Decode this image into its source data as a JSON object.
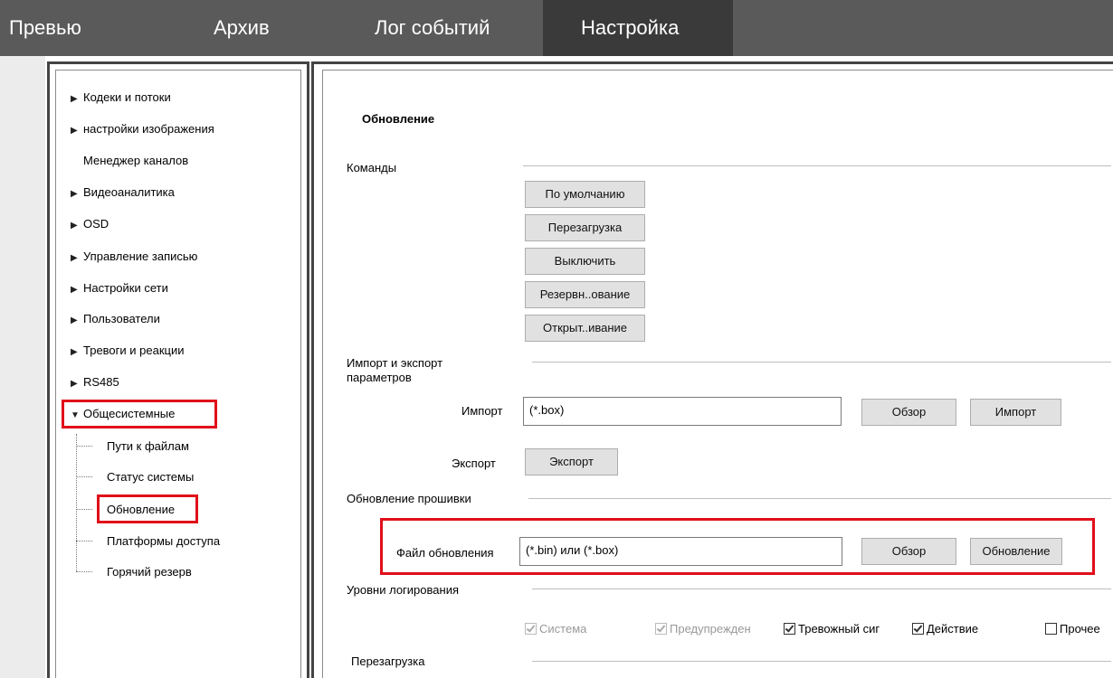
{
  "nav": {
    "tabs": [
      {
        "label": "Превью"
      },
      {
        "label": "Архив"
      },
      {
        "label": "Лог событий"
      },
      {
        "label": "Настройка"
      }
    ]
  },
  "tree": {
    "items": [
      {
        "label": "Кодеки и потоки"
      },
      {
        "label": "настройки изображения"
      },
      {
        "label": "Менеджер каналов"
      },
      {
        "label": "Видеоаналитика"
      },
      {
        "label": "OSD"
      },
      {
        "label": "Управление записью"
      },
      {
        "label": "Настройки сети"
      },
      {
        "label": "Пользователи"
      },
      {
        "label": "Тревоги и реакции"
      },
      {
        "label": "RS485"
      },
      {
        "label": "Общесистемные"
      }
    ],
    "children": [
      {
        "label": "Пути к файлам"
      },
      {
        "label": "Статус системы"
      },
      {
        "label": "Обновление"
      },
      {
        "label": "Платформы доступа"
      },
      {
        "label": "Горячий резерв"
      }
    ]
  },
  "main": {
    "title": "Обновление",
    "commands_label": "Команды",
    "commands": [
      {
        "label": "По умолчанию"
      },
      {
        "label": "Перезагрузка"
      },
      {
        "label": "Выключить"
      },
      {
        "label": "Резервн..ование"
      },
      {
        "label": "Открыт..ивание"
      }
    ],
    "import_export_label_1": "Импорт и экспорт",
    "import_export_label_2": "параметров",
    "import_label": "Импорт",
    "import_value": "(*.box)",
    "browse_label": "Обзор",
    "import_button": "Импорт",
    "export_label": "Экспорт",
    "export_button": "Экспорт",
    "firmware_label": "Обновление прошивки",
    "update_file_label": "Файл обновления",
    "update_file_value": "(*.bin) или (*.box)",
    "update_button": "Обновление",
    "log_levels_label": "Уровни логирования",
    "log_levels": [
      {
        "label": "Система",
        "checked": true,
        "disabled": true
      },
      {
        "label": "Предупрежден",
        "checked": true,
        "disabled": true
      },
      {
        "label": "Тревожный сиг",
        "checked": true,
        "disabled": false
      },
      {
        "label": "Действие",
        "checked": true,
        "disabled": false
      },
      {
        "label": "Прочее",
        "checked": false,
        "disabled": false
      }
    ],
    "reboot_label": "Перезагрузка"
  },
  "colors": {
    "nav_bg": "#5a5a5a",
    "nav_active": "#3a3a3a",
    "highlight": "#e0101a"
  }
}
